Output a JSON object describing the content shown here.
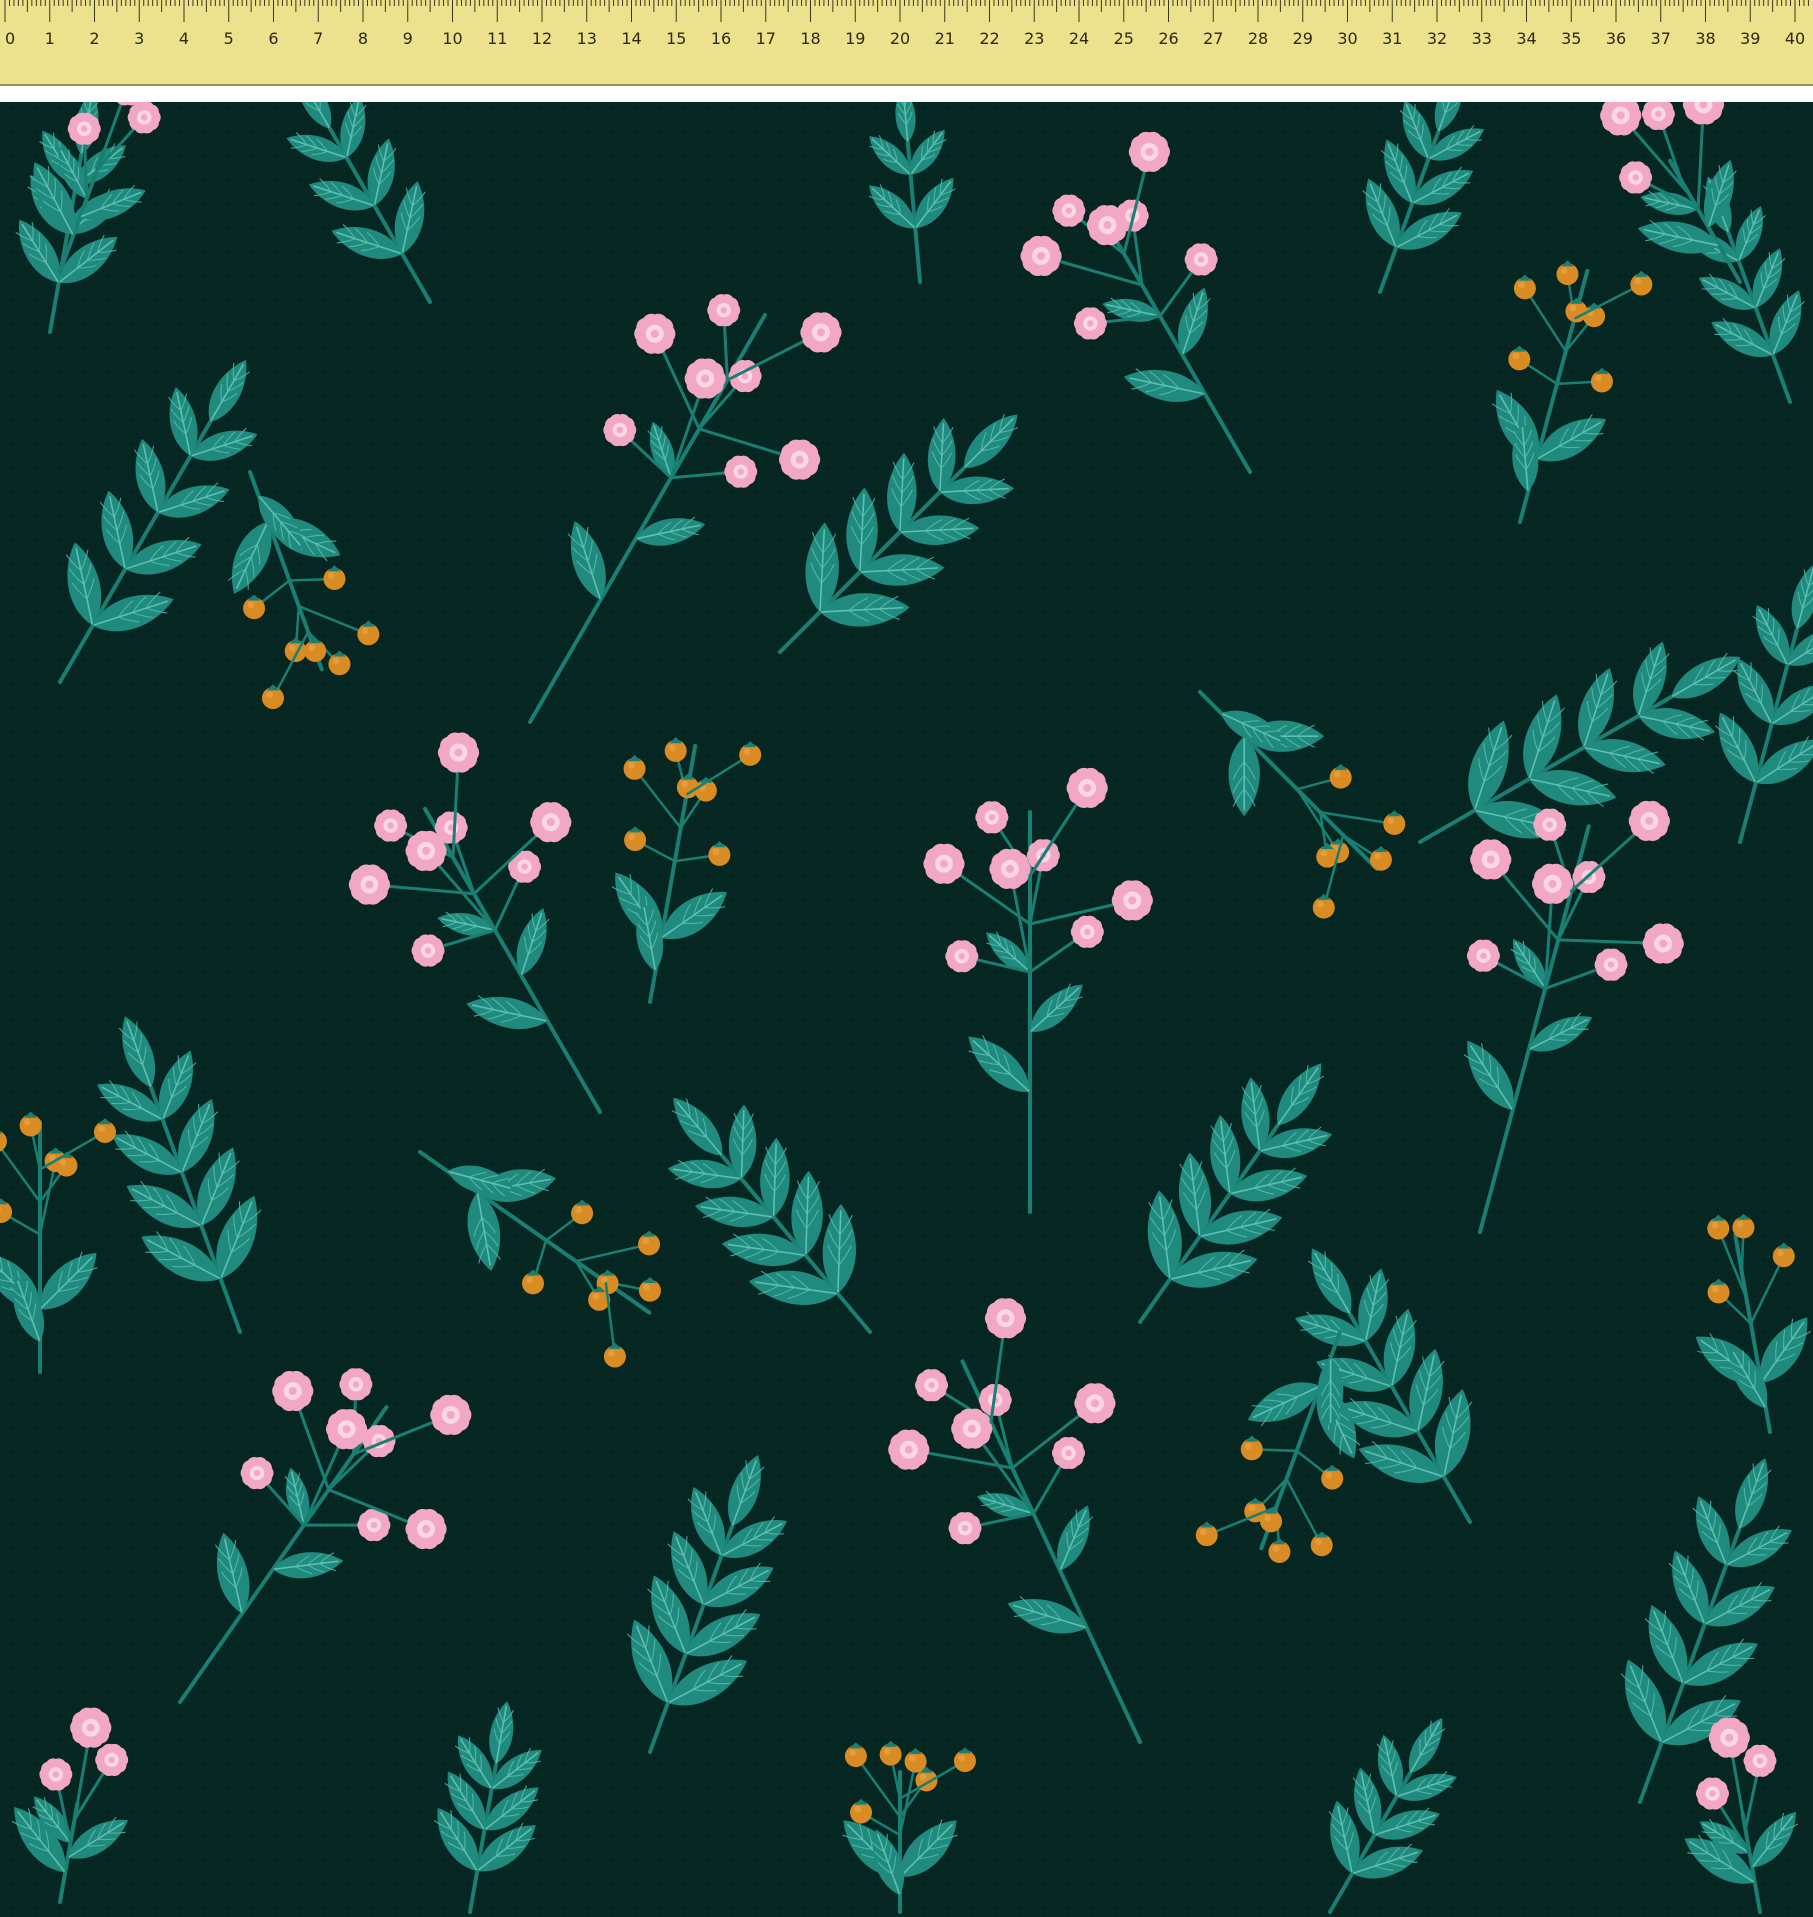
{
  "ruler": {
    "labels": [
      "0",
      "1",
      "2",
      "3",
      "4",
      "5",
      "6",
      "7",
      "8",
      "9",
      "10",
      "11",
      "12",
      "13",
      "14",
      "15",
      "16",
      "17",
      "18",
      "19",
      "20",
      "21",
      "22",
      "23",
      "24",
      "25",
      "26",
      "27",
      "28",
      "29",
      "30",
      "31",
      "32",
      "33",
      "34",
      "35",
      "36",
      "37",
      "38",
      "39",
      "40"
    ],
    "background_color": "#ece28d",
    "tick_color": "#3a3618"
  },
  "fabric": {
    "background_color": "#062622",
    "leaf_color": "#1f8a7d",
    "leaf_vein_color": "#5cc0b2",
    "stem_color": "#1a7f73",
    "flower_color": "#f2a8c4",
    "flower_center_color": "#fbd6e3",
    "berry_color": "#d98c24",
    "berry_cap_color": "#1a7f73"
  }
}
